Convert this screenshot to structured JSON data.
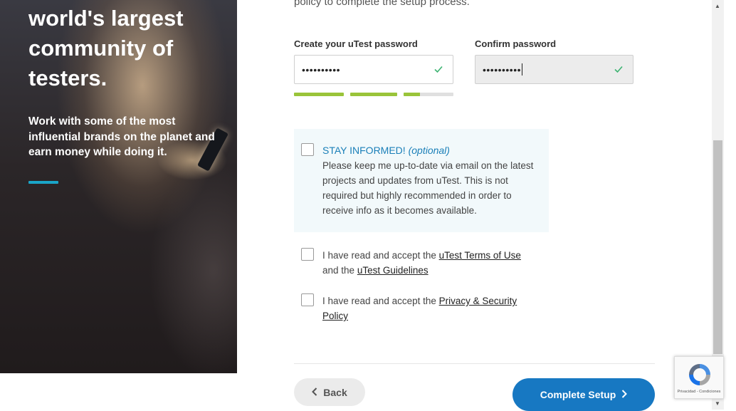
{
  "hero": {
    "title": "world's largest community of testers.",
    "subtitle": "Work with some of the most influential brands on the planet and earn money while doing it."
  },
  "intro": "policy to complete the setup process.",
  "password": {
    "label": "Create your uTest password",
    "value": "••••••••••",
    "valid": true,
    "strength_segments": [
      1,
      1,
      0.33
    ]
  },
  "confirm": {
    "label": "Confirm password",
    "value": "••••••••••",
    "valid": true
  },
  "optin": {
    "title": "STAY INFORMED!",
    "optional": "(optional)",
    "body": "Please keep me up-to-date via email on the latest projects and updates from uTest. This is not required but highly recommended in order to receive info as it becomes available."
  },
  "terms": {
    "prefix": "I have read and accept the",
    "terms_link": "uTest Terms of Use",
    "middle": "and the",
    "guidelines_link": "uTest Guidelines"
  },
  "privacy": {
    "prefix": "I have read and accept the",
    "link": "Privacy & Security Policy"
  },
  "buttons": {
    "back": "Back",
    "complete": "Complete Setup"
  },
  "recaptcha": {
    "links": "Privacidad - Condiciones"
  },
  "colors": {
    "primary": "#1778c2",
    "accent": "#1aa5c8",
    "strength": "#9ac43a",
    "valid": "#3cb371"
  }
}
